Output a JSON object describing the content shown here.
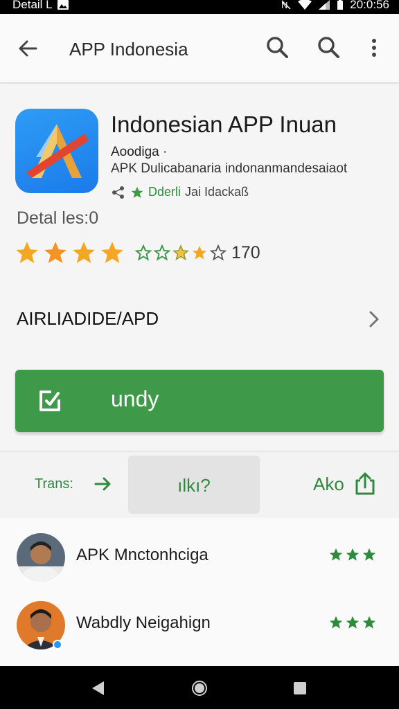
{
  "status_bar": {
    "left_text": "Detail L",
    "time": "20:0:56",
    "icons": [
      "image-icon",
      "no-sim-icon",
      "wifi-icon",
      "signal-icon",
      "battery-icon"
    ]
  },
  "app_bar": {
    "back_icon": "arrow-back-icon",
    "title": "APP Indonesia",
    "actions": [
      "search-icon",
      "search-icon",
      "more-vert-icon"
    ]
  },
  "app": {
    "name": "Indonesian APP Inuan",
    "developer": "Aoodiga ·",
    "description": "APK Dulicabanaria  indonanmandesaiaot",
    "meta_icon": "share-icon",
    "meta_verified": "Dderli",
    "meta_rest": "Jai Idackaß",
    "details_label": "Detal les:0"
  },
  "rating": {
    "large_stars": 4,
    "small_stars": [
      "empty",
      "empty",
      "filled",
      "filled",
      "empty"
    ],
    "count": "170"
  },
  "section": {
    "title": "AIRLIADIDE/APD",
    "chevron_icon": "chevron-right-icon"
  },
  "install_button": {
    "label": "undy",
    "icon": "edit-box-icon"
  },
  "actions": {
    "trans_label": "Trans:",
    "trans_icon": "arrow-forward-icon",
    "mid_label": "ılkı?",
    "share_label": "Ako",
    "share_icon": "share-icon"
  },
  "reviews": [
    {
      "name": "APK Mnctonhciga",
      "stars": 3,
      "avatar": "avatar-icon"
    },
    {
      "name": "Wabdly Neigahign",
      "stars": 3,
      "avatar": "avatar-icon"
    }
  ],
  "nav_bar": {
    "icons": [
      "nav-back-icon",
      "nav-home-icon",
      "nav-recent-icon"
    ]
  },
  "colors": {
    "accent_green": "#3e9a48",
    "text_green": "#2e8b3e",
    "star_orange": "#f5a623",
    "icon_blue": "#2196f3"
  }
}
